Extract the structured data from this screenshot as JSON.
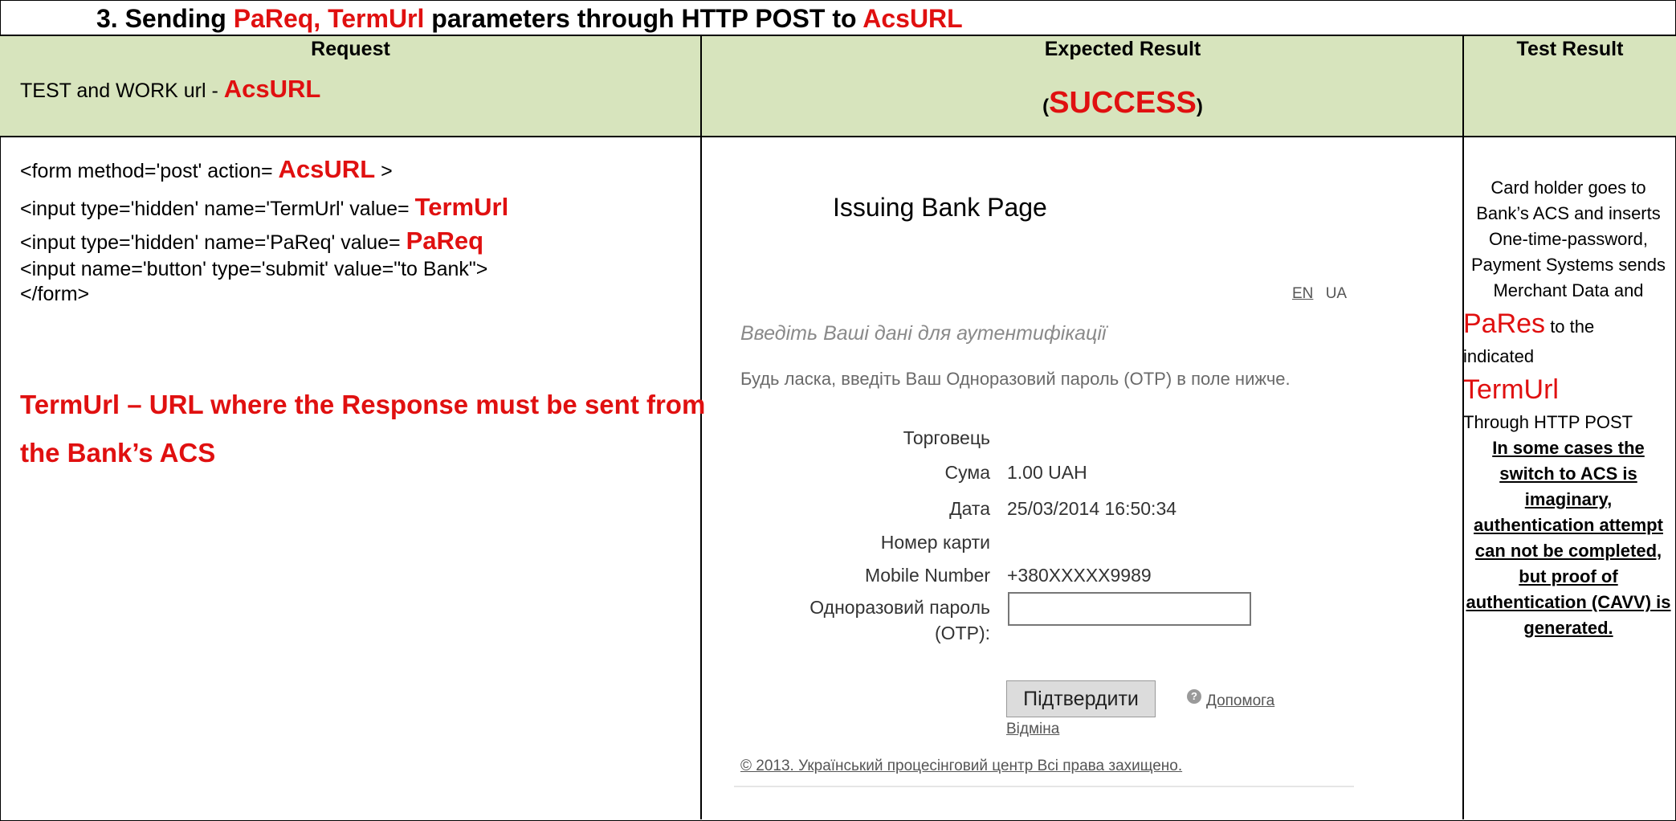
{
  "title": {
    "prefix": "3. Sending",
    "params": "PaReq, TermUrl",
    "middle": "parameters through HTTP POST to",
    "target": "AcsURL"
  },
  "header": {
    "request": "Request",
    "expected": "Expected Result",
    "test": "Test Result",
    "work_url_label": "TEST and WORK url -",
    "work_url_value": "AcsURL",
    "success_open": "(",
    "success_text": "SUCCESS",
    "success_close": ")"
  },
  "request": {
    "line1_a": "<form method='post'  action=",
    "line1_b": "AcsURL",
    "line1_c": ">",
    "line2_a": "<input type='hidden' name='TermUrl' value=",
    "line2_b": "TermUrl",
    "line3_a": "<input type='hidden' name='PaReq' value=",
    "line3_b": "PaReq",
    "line4": "<input name='button'  type='submit' value=\"to Bank\">",
    "line5": "</form>",
    "termurl_note": "TermUrl – URL where the Response must be sent from the Bank’s ACS"
  },
  "bank_page": {
    "title": "Issuing Bank Page",
    "lang_en": "EN",
    "lang_ua": "UA",
    "heading": "Введіть Ваші дані для аутентифікації",
    "intro": "Будь ласка, введіть Ваш Одноразовий пароль (OTP) в поле нижче.",
    "fields": {
      "merchant_label": "Торговець",
      "amount_label": "Сума",
      "amount_value": "1.00  UAH",
      "date_label": "Дата",
      "date_value": "25/03/2014 16:50:34",
      "card_label": "Номер карти",
      "mobile_label": "Mobile Number",
      "mobile_value": "+380XXXXX9989",
      "otp_label": "Одноразовий пароль (OTP):"
    },
    "confirm_button": "Підтвердити",
    "help_link": "Допомога",
    "cancel_link": "Відміна",
    "copyright": "© 2013. Український процесінговий центр Всі права захищено."
  },
  "test_result": {
    "text1": "Card holder goes to Bank’s ACS and inserts One-time-password, Payment Systems sends Merchant Data and",
    "pares": "PaRes",
    "to_the": "to the",
    "indicated": "indicated",
    "termurl": "TermUrl",
    "through": "Through  HTTP POST",
    "note": "In some cases the switch to ACS is imaginary, authentication attempt can not be completed, but proof of authentication (CAVV) is generated."
  }
}
